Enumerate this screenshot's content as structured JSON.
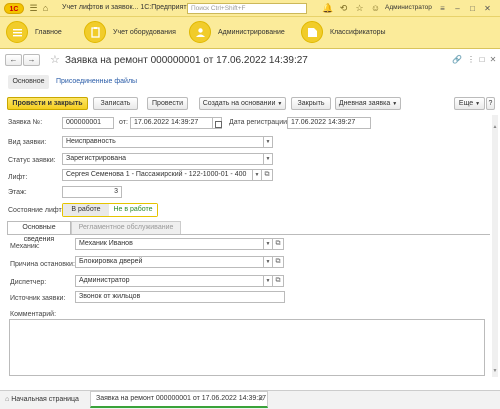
{
  "titlebar": {
    "title": "Учет лифтов и заявок...  1С:Предприятие",
    "search_placeholder": "Поиск Ctrl+Shift+F",
    "user": "Администратор",
    "logo_text": "1С"
  },
  "sections": [
    {
      "label": "Главное",
      "icon": "menu-lines-icon"
    },
    {
      "label": "Учет оборудования",
      "icon": "clipboard-icon"
    },
    {
      "label": "Администрирование",
      "icon": "admin-users-icon"
    },
    {
      "label": "Классификаторы",
      "icon": "classifier-icon"
    }
  ],
  "form": {
    "title": "Заявка на ремонт 000000001 от 17.06.2022 14:39:27"
  },
  "nav": {
    "main": "Основное",
    "files": "Присоединенные файлы"
  },
  "toolbar": {
    "post_close": "Провести и закрыть",
    "write": "Записать",
    "post": "Провести",
    "create_based": "Создать на основании",
    "close": "Закрыть",
    "daily": "Дневная заявка",
    "more": "Еще",
    "help": "?"
  },
  "fields": {
    "number_label": "Заявка №:",
    "number": "000000001",
    "from_label": "от:",
    "date": "17.06.2022 14:39:27",
    "reg_label": "Дата регистрации:",
    "reg_date": "17.06.2022 14:39:27",
    "kind_label": "Вид заявки:",
    "kind": "Неисправность",
    "status_label": "Статус заявки:",
    "status": "Зарегистрирована",
    "lift_label": "Лифт:",
    "lift": "Сергея Семенова 1 - Пассажирский - 122-1000-01 - 400",
    "floor_label": "Этаж:",
    "floor": "3",
    "lift_state_label": "Состояние лифта:",
    "lift_state_on": "В работе",
    "lift_state_off": "Не в работе"
  },
  "tabs": {
    "main": "Основные сведения",
    "reglament": "Регламентное обслуживание"
  },
  "details": {
    "mechanic_label": "Механик:",
    "mechanic": "Механик Иванов",
    "reason_label": "Причина остановки:",
    "reason": "Блокировка дверей",
    "dispatcher_label": "Диспетчер:",
    "dispatcher": "Администратор",
    "source_label": "Источник заявки:",
    "source": "Звонок от жильцов",
    "comment_label": "Комментарий:"
  },
  "bottombar": {
    "home": "Начальная страница",
    "doc_tab": "Заявка на ремонт 000000001 от 17.06.2022 14:39:27"
  }
}
